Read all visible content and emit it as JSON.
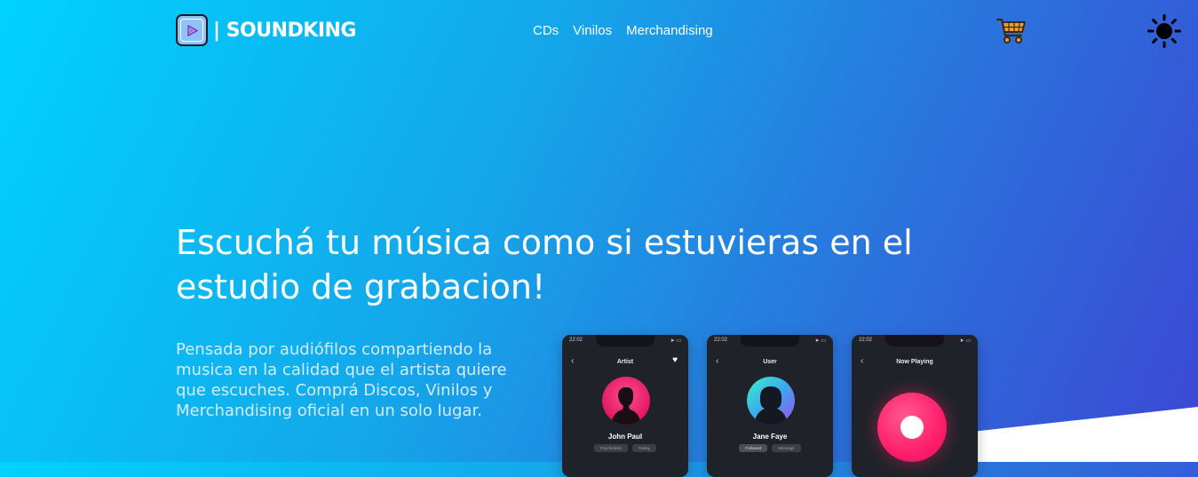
{
  "brand": {
    "name": "| SOUNDKING"
  },
  "nav": {
    "items": [
      "CDs",
      "Vinilos",
      "Merchandising"
    ]
  },
  "header_icons": {
    "cart": "cart-icon",
    "theme": "sun-icon"
  },
  "hero": {
    "title": "Escuchá tu música como si estuvieras en el estudio de grabacion!",
    "subtitle": "Pensada por audiófilos compartiendo la musica en la calidad que el artista quiere que escuches. Comprá Discos, Vinilos y Merchandising oficial en un solo lugar."
  },
  "phones": [
    {
      "time": "22:02",
      "title": "Artist",
      "name": "John Paul",
      "chip1": "Psychedelic",
      "chip2": "Rating"
    },
    {
      "time": "22:02",
      "title": "User",
      "name": "Jane Faye",
      "chip1": "Followed",
      "chip2": "Message"
    },
    {
      "time": "22:02",
      "title": "Now Playing"
    }
  ],
  "colors": {
    "gradient_start": "#00d2ff",
    "gradient_end": "#3c47d5",
    "accent_pink": "#ff1e6a"
  }
}
